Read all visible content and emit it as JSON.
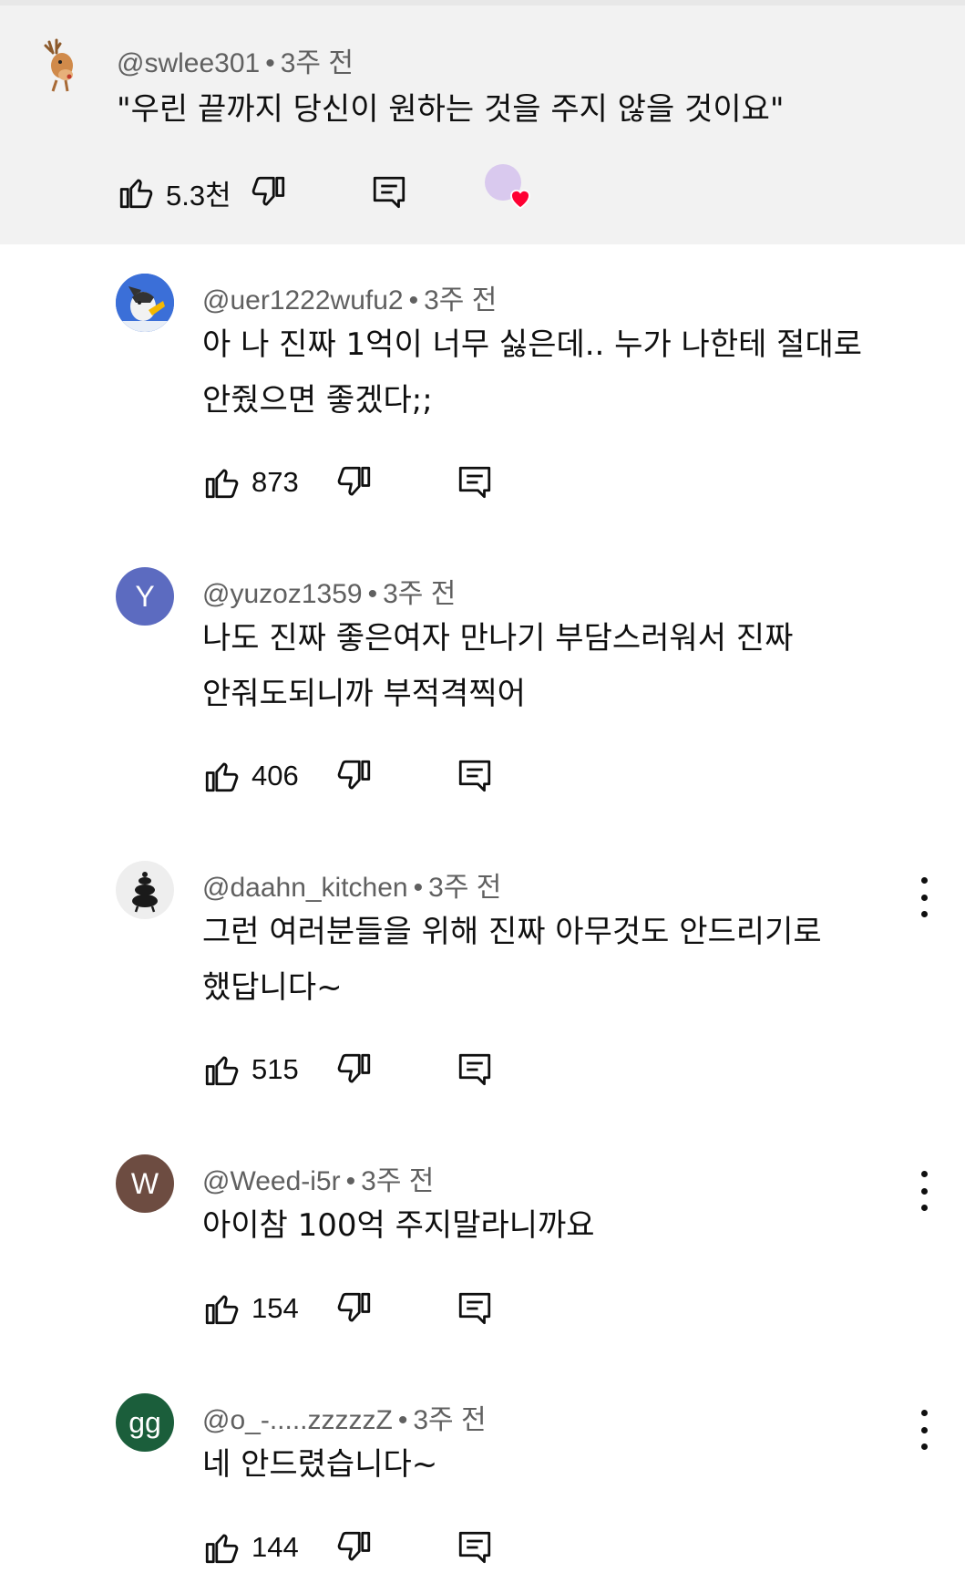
{
  "top_comment": {
    "author": "@swlee301",
    "time": "3주 전",
    "text": "\"우린 끝까지 당신이 원하는 것을 주지 않을 것이요\"",
    "likes": "5.3천",
    "avatar_icon": "deer-icon",
    "hearted": true
  },
  "replies": [
    {
      "author": "@uer1222wufu2",
      "time": "3주 전",
      "lines": [
        "아 나 진짜 1억이 너무 싫은데.. 누가 나한테 절대로",
        "안줬으면 좋겠다;;"
      ],
      "likes": "873",
      "avatar_icon": "husky-icon",
      "avatar_color": "#2f63c9"
    },
    {
      "author": "@yuzoz1359",
      "time": "3주 전",
      "lines": [
        "나도 진짜 좋은여자 만나기 부담스러워서 진짜",
        "안줘도되니까 부적격찍어"
      ],
      "likes": "406",
      "avatar_letter": "Y",
      "avatar_color": "#5c6bc0"
    },
    {
      "author": "@daahn_kitchen",
      "time": "3주 전",
      "lines": [
        "그런 여러분들을 위해 진짜 아무것도 안드리기로",
        "했답니다~"
      ],
      "likes": "515",
      "avatar_icon": "animal-stack-icon",
      "avatar_color": "#eeeeee"
    },
    {
      "author": "@Weed-i5r",
      "time": "3주 전",
      "lines": [
        "아이참 100억 주지말라니까요"
      ],
      "likes": "154",
      "avatar_letter": "W",
      "avatar_color": "#6d4c41"
    },
    {
      "author": "@o_-.....zzzzzZ",
      "time": "3주 전",
      "lines": [
        "네 안드렸습니다~"
      ],
      "likes": "144",
      "avatar_letter": "gg",
      "avatar_color": "#1b5e3b"
    }
  ],
  "colors": {
    "top_bg": "#f2f2f2",
    "meta_text": "#606060",
    "heart": "#ff0033"
  }
}
